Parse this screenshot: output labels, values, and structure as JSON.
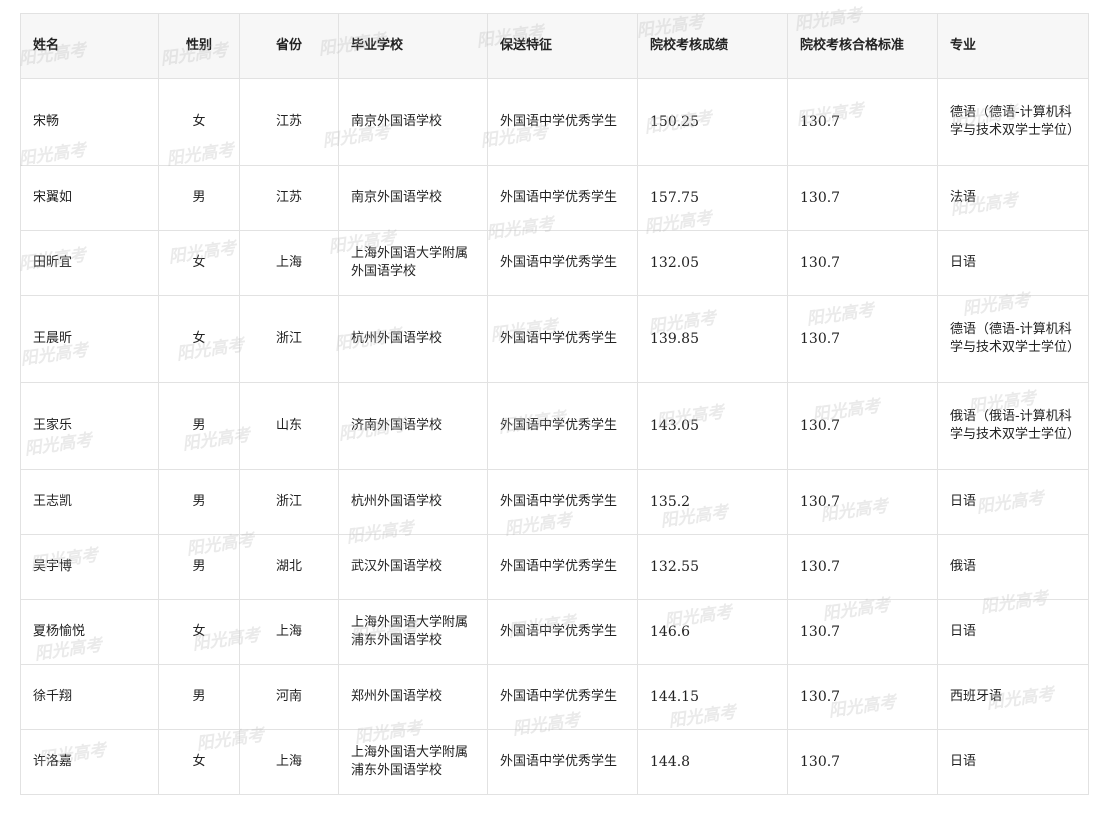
{
  "table": {
    "headers": [
      "姓名",
      "性别",
      "省份",
      "毕业学校",
      "保送特征",
      "院校考核成绩",
      "院校考核合格标准",
      "专业"
    ],
    "rows": [
      [
        "宋畅",
        "女",
        "江苏",
        "南京外国语学校",
        "外国语中学优秀学生",
        "150.25",
        "130.7",
        "德语（德语-计算机科学与技术双学士学位）"
      ],
      [
        "宋翼如",
        "男",
        "江苏",
        "南京外国语学校",
        "外国语中学优秀学生",
        "157.75",
        "130.7",
        "法语"
      ],
      [
        "田昕宜",
        "女",
        "上海",
        "上海外国语大学附属外国语学校",
        "外国语中学优秀学生",
        "132.05",
        "130.7",
        "日语"
      ],
      [
        "王晨昕",
        "女",
        "浙江",
        "杭州外国语学校",
        "外国语中学优秀学生",
        "139.85",
        "130.7",
        "德语（德语-计算机科学与技术双学士学位）"
      ],
      [
        "王家乐",
        "男",
        "山东",
        "济南外国语学校",
        "外国语中学优秀学生",
        "143.05",
        "130.7",
        "俄语（俄语-计算机科学与技术双学士学位）"
      ],
      [
        "王志凯",
        "男",
        "浙江",
        "杭州外国语学校",
        "外国语中学优秀学生",
        "135.2",
        "130.7",
        "日语"
      ],
      [
        "吴宇博",
        "男",
        "湖北",
        "武汉外国语学校",
        "外国语中学优秀学生",
        "132.55",
        "130.7",
        "俄语"
      ],
      [
        "夏杨愉悦",
        "女",
        "上海",
        "上海外国语大学附属浦东外国语学校",
        "外国语中学优秀学生",
        "146.6",
        "130.7",
        "日语"
      ],
      [
        "徐千翔",
        "男",
        "河南",
        "郑州外国语学校",
        "外国语中学优秀学生",
        "144.15",
        "130.7",
        "西班牙语"
      ],
      [
        "许洛嘉",
        "女",
        "上海",
        "上海外国语大学附属浦东外国语学校",
        "外国语中学优秀学生",
        "144.8",
        "130.7",
        "日语"
      ]
    ]
  },
  "watermark": {
    "text": "阳光高考"
  }
}
